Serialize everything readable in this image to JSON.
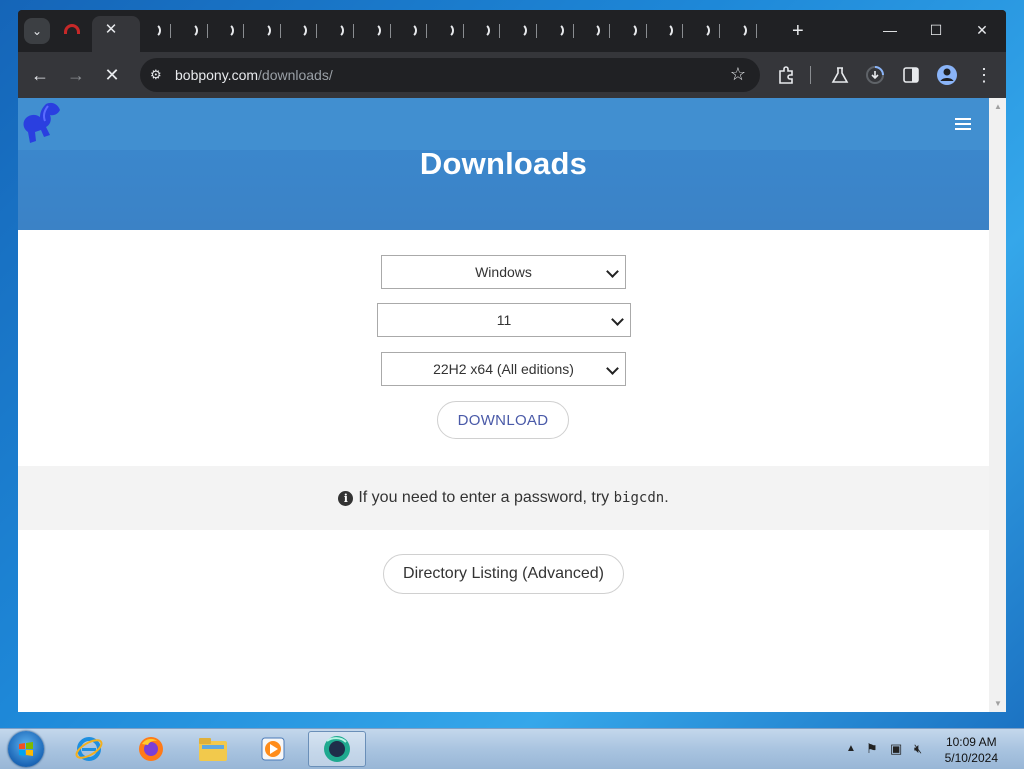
{
  "browser": {
    "active_tab_close": "✕",
    "spinner_tab_count": 17,
    "new_tab": "+",
    "window_controls": {
      "minimize": "—",
      "maximize": "☐",
      "close": "✕"
    },
    "toolbar": {
      "back": "←",
      "forward": "→",
      "stop": "✕",
      "url_host": "bobpony.com",
      "url_path": "/downloads/",
      "bookmark": "☆"
    }
  },
  "page": {
    "title": "Downloads",
    "os_select": "Windows",
    "version_select": "11",
    "edition_select": "22H2 x64 (All editions)",
    "download_button": "DOWNLOAD",
    "notice_prefix": "If you need to enter a password, try",
    "notice_password": "bigcdn",
    "notice_suffix": ".",
    "directory_button": "Directory Listing (Advanced)",
    "colors": {
      "hero": "#3b87cc",
      "download_text": "#4a5aa8"
    }
  },
  "taskbar": {
    "clock_time": "10:09 AM",
    "clock_date": "5/10/2024",
    "apps": [
      "internet-explorer",
      "firefox",
      "file-explorer",
      "media-player",
      "browser-active"
    ]
  }
}
